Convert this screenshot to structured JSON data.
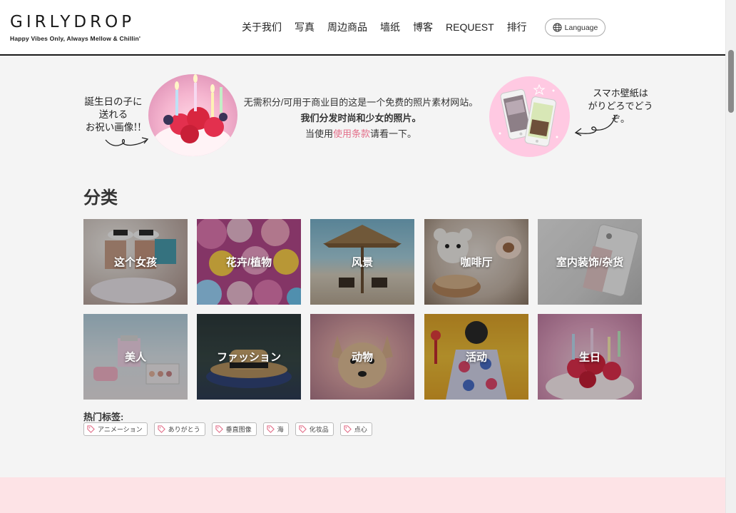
{
  "header": {
    "logo_title": "GIRLYDROP",
    "logo_tagline": "Happy Vibes Only, Always Mellow & Chillin'",
    "nav": [
      "关于我们",
      "写真",
      "周边商品",
      "墙纸",
      "博客",
      "REQUEST",
      "排行"
    ],
    "language_label": "Language"
  },
  "intro": {
    "left_handwriting": [
      "誕生日の子に",
      "送れる",
      "お祝い画像!!"
    ],
    "right_handwriting": [
      "スマホ壁紙は",
      "がりどろでどうぞ。"
    ],
    "line1": "无需积分/可用于商业目的这是一个免费的照片素材网站。",
    "line2": "我们分发时尚和少女的照片。",
    "line3_prefix": "当使用",
    "line3_link": "使用条款",
    "line3_suffix": "请看一下。"
  },
  "category": {
    "title": "分类",
    "tiles": [
      {
        "label": "这个女孩",
        "name": "girl"
      },
      {
        "label": "花卉/植物",
        "name": "flowers"
      },
      {
        "label": "风景",
        "name": "scenery"
      },
      {
        "label": "咖啡厅",
        "name": "cafe"
      },
      {
        "label": "室内装饰/杂货",
        "name": "interior"
      },
      {
        "label": "美人",
        "name": "beauty"
      },
      {
        "label": "ファッション",
        "name": "fashion"
      },
      {
        "label": "动物",
        "name": "animals"
      },
      {
        "label": "活动",
        "name": "events"
      },
      {
        "label": "生日",
        "name": "birthday"
      }
    ]
  },
  "tags": {
    "title": "热门标签:",
    "items": [
      "アニメーション",
      "ありがとう",
      "垂直图像",
      "海",
      "化妆品",
      "点心"
    ]
  },
  "colors": {
    "accent_link": "#e36f8a",
    "pink_band": "#fde3e6",
    "page_bg": "#f4f4f4"
  }
}
